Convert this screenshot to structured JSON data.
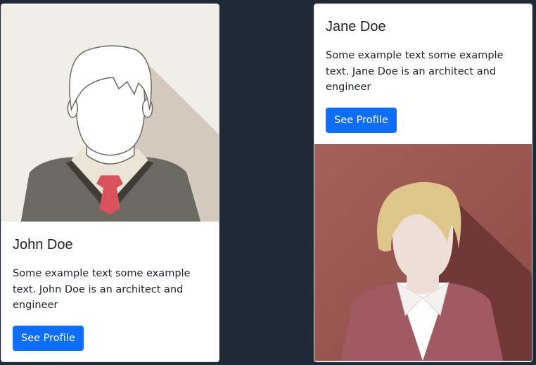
{
  "cards": [
    {
      "name": "John Doe",
      "text": "Some example text some example text. John Doe is an architect and engineer",
      "button_label": "See Profile"
    },
    {
      "name": "Jane Doe",
      "text": "Some example text some example text. Jane Doe is an architect and engineer",
      "button_label": "See Profile"
    }
  ],
  "colors": {
    "page_background": "#1f2a36",
    "button": "#0d6efd",
    "john_avatar_bg": "#f2efe9",
    "jane_avatar_bg": "#a9615a"
  }
}
